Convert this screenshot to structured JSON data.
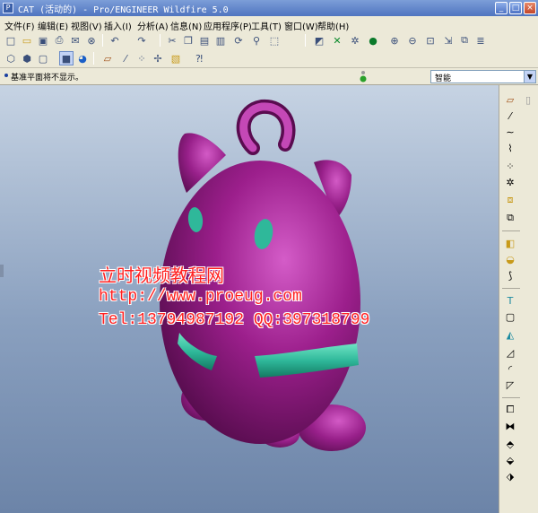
{
  "window": {
    "title": "CAT (活动的) - Pro/ENGINEER Wildfire 5.0",
    "app_icon": "P",
    "minimize_icon": "minimize-icon",
    "maximize_icon": "maximize-icon",
    "close_icon": "close-icon"
  },
  "menu": {
    "items": [
      "文件(F)",
      "编辑(E)",
      "视图(V)",
      "插入(I)",
      "分析(A)",
      "信息(N)",
      "应用程序(P)",
      "工具(T)",
      "窗口(W)",
      "帮助(H)"
    ]
  },
  "toolbar_top": {
    "icons": [
      "new-icon",
      "open-icon",
      "save-icon",
      "print-icon",
      "email-icon",
      "close-window-icon",
      "undo-icon",
      "redo-icon",
      "cut-icon",
      "copy-icon",
      "paste-icon",
      "paste-special-icon",
      "regenerate-icon",
      "find-icon",
      "select-box-icon",
      "sketch-icon",
      "datum-axis-icon",
      "spin-center-icon",
      "appearance-icon",
      "zoom-in-icon",
      "zoom-out-icon",
      "refit-icon",
      "reorient-icon",
      "saved-views-icon",
      "layers-icon"
    ]
  },
  "toolbar_second": {
    "icons": [
      "wireframe-icon",
      "hidden-line-icon",
      "no-hidden-icon",
      "shading-icon",
      "enhanced-realism-icon",
      "datum-planes-icon",
      "datum-axes-icon",
      "datum-points-icon",
      "coordinate-systems-icon",
      "annotations-icon",
      "context-help-icon"
    ]
  },
  "status": {
    "message": "基准平面将不显示。",
    "filter_value": "智能"
  },
  "watermark": {
    "line1": "立时视频教程网",
    "line2": "http://www.proeug.com",
    "line3": "Tel:13794987192  QQ:397318799"
  },
  "right_toolbar": {
    "icons": [
      "datum-plane-icon",
      "datum-axis-tool-icon",
      "datum-curve-icon",
      "sketched-curve-icon",
      "datum-point-icon",
      "csys-icon",
      "analysis-feature-icon",
      "extrude-icon",
      "revolve-icon",
      "variable-section-sweep-icon",
      "boundary-blend-icon",
      "style-icon",
      "hole-icon",
      "round-icon",
      "draft-icon",
      "shell-icon",
      "rib-icon",
      "pattern-icon",
      "mirror-icon",
      "merge-icon",
      "trim-icon",
      "thicken-icon",
      "solidify-icon"
    ]
  },
  "colors": {
    "body": "#9c1f8c",
    "accent": "#2fb89a",
    "watermark": "#ff2020",
    "background_top": "#c6d3e3",
    "background_bottom": "#6c84a8"
  }
}
